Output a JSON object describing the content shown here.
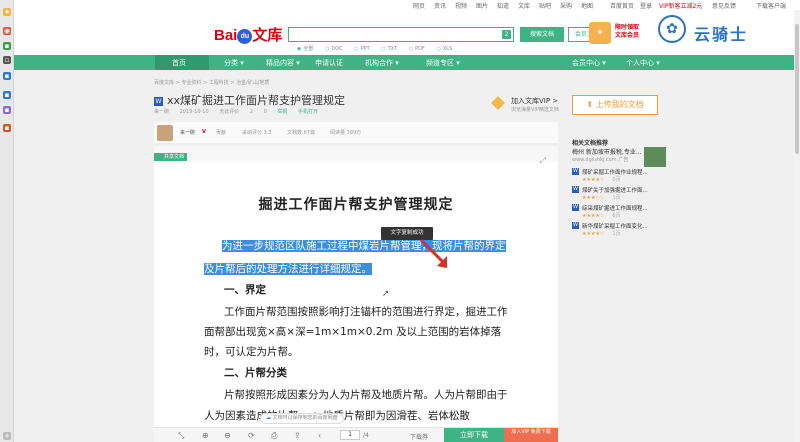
{
  "toplinks": [
    "网页",
    "资讯",
    "视频",
    "图片",
    "知道",
    "文库",
    "贴吧",
    "采购",
    "地图",
    "百度首页",
    "登录",
    "VIP新客立减2元",
    "意见反馈",
    "下载客户端"
  ],
  "header": {
    "logo_text": "Bai",
    "logo_paw": "du",
    "logo_lib": "文库",
    "search_badge": "2",
    "search_button": "搜索文档",
    "vip_search_button": "会员文档",
    "filters": [
      "全部",
      "DOC",
      "PPT",
      "TXT",
      "PDF",
      "XLS"
    ],
    "promo_line1": "限时領取",
    "promo_line2": "文库会员",
    "watermark": "云骑士"
  },
  "nav": {
    "items": [
      "首页",
      "分类 ▾",
      "精品内容 ▾",
      "申请认证",
      "机构合作 ▾",
      "频道专区 ▾",
      "会员中心 ▾",
      "个人中心 ▾"
    ]
  },
  "doc": {
    "breadcrumb": "百度文库 > 专业资料 > 工程科技 > 冶金/矿山/地质",
    "title": "xx煤矿掘进工作面片帮支护管理规定",
    "title_icon": "W",
    "meta": [
      "来一碗",
      "2019-10-10",
      "无此评价",
      "2",
      "0",
      "举报",
      "手机打开"
    ],
    "author_name": "来一碗",
    "author_v": "V",
    "author_stats": [
      "贡献",
      "采纳评分 3.3",
      "文档数 67篇",
      "阅读量 399万"
    ],
    "tag": "共享文档",
    "vip_join_title": "加入文库VIP >",
    "vip_join_sub": "浏览海量VIP精选文档",
    "heading": "掘进工作面片帮支护管理规定",
    "para1_sel1": "为进一步规范区队施工过程中煤岩片帮管理，现将片帮的界定",
    "para1_sel2": "及片帮后的处理方法进行详细规定。",
    "sec1": "一、界定",
    "para2_l1": "工作面片帮范围按照影响打注锚杆的范围进行界定，掘进工作",
    "para2_l2": "面帮部出现宽×高×深=1m×1m×0.2m 及以上范围的岩体掉落",
    "para2_l3": "时，可认定为片帮。",
    "sec2": "二、片帮分类",
    "para3_l1": "片帮按照形成因素分为人为片帮及地质片帮。人为片帮即由于",
    "para3_l2": "人为因素造成的片帮，    ；地质片帮即为因滑茬、岩体松散",
    "tooltip": "文字复制成功",
    "store_tip": "文档可以保存到您的百度网盘",
    "page_input": "1",
    "page_total": "/4",
    "bottom_dl": "下载券",
    "free_dl": "立即下载",
    "vip_dl": "加入VIP 免费下载"
  },
  "sidebar_right": {
    "upload": "上传我的文档",
    "related_title": "相关文档推荐",
    "ad_title": "梅州 新加坡市报税,专业...",
    "ad_url": "www.dgsshkj.com",
    "ad_tag": "广告",
    "items": [
      {
        "title": "煤矿采掘工作面作业规程...",
        "stars": "★★★★☆",
        "pages": "0页"
      },
      {
        "title": "煤矿关于加强掘进工作面...",
        "stars": "★★★☆☆",
        "pages": "1页"
      },
      {
        "title": "综采煤矿掘进工作面规程...",
        "stars": "★★★★☆",
        "pages": "6页"
      },
      {
        "title": "新华煤矿采掘工作面变化...",
        "stars": "★★★★☆",
        "pages": "1页"
      }
    ]
  },
  "colors": {
    "accent": "#3eb484",
    "selection": "#3b8fe0",
    "brand_red": "#d7000f",
    "orange": "#f39b3a"
  }
}
